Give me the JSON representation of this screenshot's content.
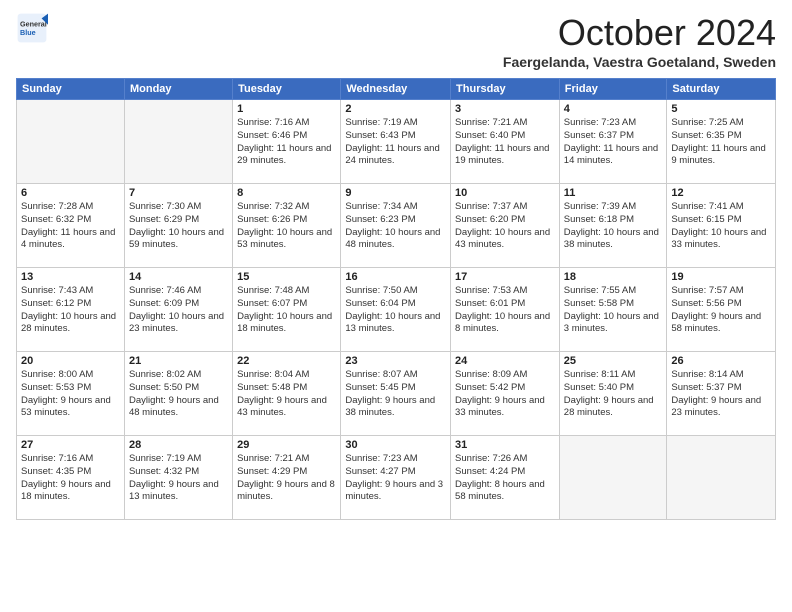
{
  "logo": {
    "general": "General",
    "blue": "Blue"
  },
  "header": {
    "month": "October 2024",
    "location": "Faergelanda, Vaestra Goetaland, Sweden"
  },
  "weekdays": [
    "Sunday",
    "Monday",
    "Tuesday",
    "Wednesday",
    "Thursday",
    "Friday",
    "Saturday"
  ],
  "weeks": [
    [
      {
        "day": "",
        "info": ""
      },
      {
        "day": "",
        "info": ""
      },
      {
        "day": "1",
        "info": "Sunrise: 7:16 AM\nSunset: 6:46 PM\nDaylight: 11 hours and 29 minutes."
      },
      {
        "day": "2",
        "info": "Sunrise: 7:19 AM\nSunset: 6:43 PM\nDaylight: 11 hours and 24 minutes."
      },
      {
        "day": "3",
        "info": "Sunrise: 7:21 AM\nSunset: 6:40 PM\nDaylight: 11 hours and 19 minutes."
      },
      {
        "day": "4",
        "info": "Sunrise: 7:23 AM\nSunset: 6:37 PM\nDaylight: 11 hours and 14 minutes."
      },
      {
        "day": "5",
        "info": "Sunrise: 7:25 AM\nSunset: 6:35 PM\nDaylight: 11 hours and 9 minutes."
      }
    ],
    [
      {
        "day": "6",
        "info": "Sunrise: 7:28 AM\nSunset: 6:32 PM\nDaylight: 11 hours and 4 minutes."
      },
      {
        "day": "7",
        "info": "Sunrise: 7:30 AM\nSunset: 6:29 PM\nDaylight: 10 hours and 59 minutes."
      },
      {
        "day": "8",
        "info": "Sunrise: 7:32 AM\nSunset: 6:26 PM\nDaylight: 10 hours and 53 minutes."
      },
      {
        "day": "9",
        "info": "Sunrise: 7:34 AM\nSunset: 6:23 PM\nDaylight: 10 hours and 48 minutes."
      },
      {
        "day": "10",
        "info": "Sunrise: 7:37 AM\nSunset: 6:20 PM\nDaylight: 10 hours and 43 minutes."
      },
      {
        "day": "11",
        "info": "Sunrise: 7:39 AM\nSunset: 6:18 PM\nDaylight: 10 hours and 38 minutes."
      },
      {
        "day": "12",
        "info": "Sunrise: 7:41 AM\nSunset: 6:15 PM\nDaylight: 10 hours and 33 minutes."
      }
    ],
    [
      {
        "day": "13",
        "info": "Sunrise: 7:43 AM\nSunset: 6:12 PM\nDaylight: 10 hours and 28 minutes."
      },
      {
        "day": "14",
        "info": "Sunrise: 7:46 AM\nSunset: 6:09 PM\nDaylight: 10 hours and 23 minutes."
      },
      {
        "day": "15",
        "info": "Sunrise: 7:48 AM\nSunset: 6:07 PM\nDaylight: 10 hours and 18 minutes."
      },
      {
        "day": "16",
        "info": "Sunrise: 7:50 AM\nSunset: 6:04 PM\nDaylight: 10 hours and 13 minutes."
      },
      {
        "day": "17",
        "info": "Sunrise: 7:53 AM\nSunset: 6:01 PM\nDaylight: 10 hours and 8 minutes."
      },
      {
        "day": "18",
        "info": "Sunrise: 7:55 AM\nSunset: 5:58 PM\nDaylight: 10 hours and 3 minutes."
      },
      {
        "day": "19",
        "info": "Sunrise: 7:57 AM\nSunset: 5:56 PM\nDaylight: 9 hours and 58 minutes."
      }
    ],
    [
      {
        "day": "20",
        "info": "Sunrise: 8:00 AM\nSunset: 5:53 PM\nDaylight: 9 hours and 53 minutes."
      },
      {
        "day": "21",
        "info": "Sunrise: 8:02 AM\nSunset: 5:50 PM\nDaylight: 9 hours and 48 minutes."
      },
      {
        "day": "22",
        "info": "Sunrise: 8:04 AM\nSunset: 5:48 PM\nDaylight: 9 hours and 43 minutes."
      },
      {
        "day": "23",
        "info": "Sunrise: 8:07 AM\nSunset: 5:45 PM\nDaylight: 9 hours and 38 minutes."
      },
      {
        "day": "24",
        "info": "Sunrise: 8:09 AM\nSunset: 5:42 PM\nDaylight: 9 hours and 33 minutes."
      },
      {
        "day": "25",
        "info": "Sunrise: 8:11 AM\nSunset: 5:40 PM\nDaylight: 9 hours and 28 minutes."
      },
      {
        "day": "26",
        "info": "Sunrise: 8:14 AM\nSunset: 5:37 PM\nDaylight: 9 hours and 23 minutes."
      }
    ],
    [
      {
        "day": "27",
        "info": "Sunrise: 7:16 AM\nSunset: 4:35 PM\nDaylight: 9 hours and 18 minutes."
      },
      {
        "day": "28",
        "info": "Sunrise: 7:19 AM\nSunset: 4:32 PM\nDaylight: 9 hours and 13 minutes."
      },
      {
        "day": "29",
        "info": "Sunrise: 7:21 AM\nSunset: 4:29 PM\nDaylight: 9 hours and 8 minutes."
      },
      {
        "day": "30",
        "info": "Sunrise: 7:23 AM\nSunset: 4:27 PM\nDaylight: 9 hours and 3 minutes."
      },
      {
        "day": "31",
        "info": "Sunrise: 7:26 AM\nSunset: 4:24 PM\nDaylight: 8 hours and 58 minutes."
      },
      {
        "day": "",
        "info": ""
      },
      {
        "day": "",
        "info": ""
      }
    ]
  ]
}
